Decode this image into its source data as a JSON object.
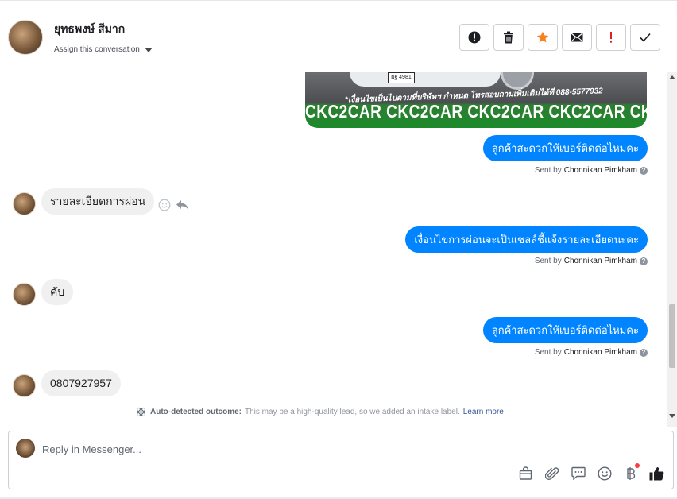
{
  "header": {
    "contact_name": "ยุทธพงษ์ สีมาก",
    "assign_label": "Assign this conversation",
    "toolbar": [
      {
        "name": "report-spam-button",
        "icon": "exclamation-circle-icon"
      },
      {
        "name": "delete-button",
        "icon": "trash-icon"
      },
      {
        "name": "star-button",
        "icon": "star-icon",
        "color": "#f5821f"
      },
      {
        "name": "mark-unread-button",
        "icon": "envelope-icon"
      },
      {
        "name": "follow-up-button",
        "icon": "exclamation-icon",
        "color": "#e02020"
      },
      {
        "name": "mark-done-button",
        "icon": "checkmark-icon"
      }
    ]
  },
  "attachment": {
    "plate_text": "ผฐ 4981",
    "caption": "*เงื่อนไขเป็นไปตามที่บริษัทฯ กำหนด โทรสอบถามเพิ่มเติมได้ที่ 088-5577932",
    "banner": "CKC2CAR CKC2CAR CKC2CAR CKC2CAR CKC2"
  },
  "messages": [
    {
      "dir": "out",
      "text": "ลูกค้าสะดวกให้เบอร์ติดต่อไหมคะ",
      "sent_by_prefix": "Sent by",
      "sender": "Chonnikan Pimkham"
    },
    {
      "dir": "in",
      "text": "รายละเอียดการผ่อน"
    },
    {
      "dir": "out",
      "text": "เงื่อนไขการผ่อนจะเป็นเซลล์ชี้แจ้งรายละเอียดนะคะ",
      "sent_by_prefix": "Sent by",
      "sender": "Chonnikan Pimkham"
    },
    {
      "dir": "in",
      "text": "คับ"
    },
    {
      "dir": "out",
      "text": "ลูกค้าสะดวกให้เบอร์ติดต่อไหมคะ",
      "sent_by_prefix": "Sent by",
      "sender": "Chonnikan Pimkham"
    },
    {
      "dir": "in",
      "text": "0807927957"
    }
  ],
  "notice": {
    "label": "Auto-detected outcome:",
    "text": "This may be a high-quality lead, so we added an intake label.",
    "link": "Learn more"
  },
  "composer": {
    "placeholder": "Reply in Messenger...",
    "icons": [
      "shopping-bag-icon",
      "paperclip-icon",
      "saved-reply-icon",
      "emoji-icon",
      "baht-payment-icon",
      "thumbs-up-icon"
    ]
  }
}
